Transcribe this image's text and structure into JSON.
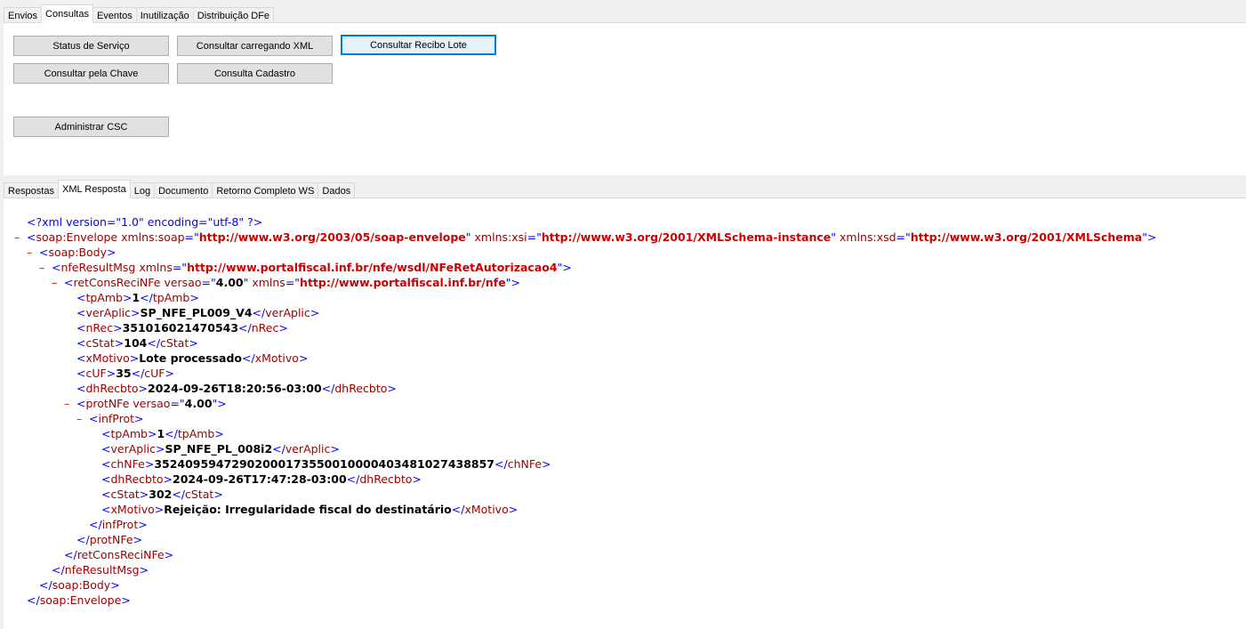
{
  "top_tabs": [
    {
      "label": "Envios",
      "active": false
    },
    {
      "label": "Consultas",
      "active": true
    },
    {
      "label": "Eventos",
      "active": false
    },
    {
      "label": "Inutilização",
      "active": false
    },
    {
      "label": "Distribuição DFe",
      "active": false
    }
  ],
  "buttons": {
    "status_servico": "Status de Serviço",
    "consultar_xml": "Consultar carregando XML",
    "consultar_recibo": "Consultar Recibo Lote",
    "consultar_chave": "Consultar pela Chave",
    "consulta_cadastro": "Consulta Cadastro",
    "administrar_csc": "Administrar CSC"
  },
  "bottom_tabs": [
    {
      "label": "Respostas",
      "active": false
    },
    {
      "label": "XML Resposta",
      "active": true
    },
    {
      "label": "Log",
      "active": false
    },
    {
      "label": "Documento",
      "active": false
    },
    {
      "label": "Retorno Completo WS",
      "active": false
    },
    {
      "label": "Dados",
      "active": false
    }
  ],
  "xml": {
    "decl": "<?xml version=\"1.0\" encoding=\"utf-8\" ?>",
    "envelope_tag": "soap:Envelope",
    "attr_soap_name": "xmlns:soap",
    "attr_soap_val": "http://www.w3.org/2003/05/soap-envelope",
    "attr_xsi_name": "xmlns:xsi",
    "attr_xsi_val": "http://www.w3.org/2001/XMLSchema-instance",
    "attr_xsd_name": "xmlns:xsd",
    "attr_xsd_val": "http://www.w3.org/2001/XMLSchema",
    "body_tag": "soap:Body",
    "result_tag": "nfeResultMsg",
    "result_xmlns_name": "xmlns",
    "result_xmlns_val": "http://www.portalfiscal.inf.br/nfe/wsdl/NFeRetAutorizacao4",
    "ret_tag": "retConsReciNFe",
    "ret_versao_name": "versao",
    "ret_versao_val": "4.00",
    "ret_xmlns_name": "xmlns",
    "ret_xmlns_val": "http://www.portalfiscal.inf.br/nfe",
    "ret_fields": [
      {
        "tag": "tpAmb",
        "value": "1"
      },
      {
        "tag": "verAplic",
        "value": "SP_NFE_PL009_V4"
      },
      {
        "tag": "nRec",
        "value": "351016021470543"
      },
      {
        "tag": "cStat",
        "value": "104"
      },
      {
        "tag": "xMotivo",
        "value": "Lote processado"
      },
      {
        "tag": "cUF",
        "value": "35"
      },
      {
        "tag": "dhRecbto",
        "value": "2024-09-26T18:20:56-03:00"
      }
    ],
    "prot_tag": "protNFe",
    "prot_versao_name": "versao",
    "prot_versao_val": "4.00",
    "inf_tag": "infProt",
    "inf_fields": [
      {
        "tag": "tpAmb",
        "value": "1"
      },
      {
        "tag": "verAplic",
        "value": "SP_NFE_PL_008i2"
      },
      {
        "tag": "chNFe",
        "value": "35240959472902000173550010000403481027438857"
      },
      {
        "tag": "dhRecbto",
        "value": "2024-09-26T17:47:28-03:00"
      },
      {
        "tag": "cStat",
        "value": "302"
      },
      {
        "tag": "xMotivo",
        "value": "Rejeição: Irregularidade fiscal do destinatário"
      }
    ]
  }
}
